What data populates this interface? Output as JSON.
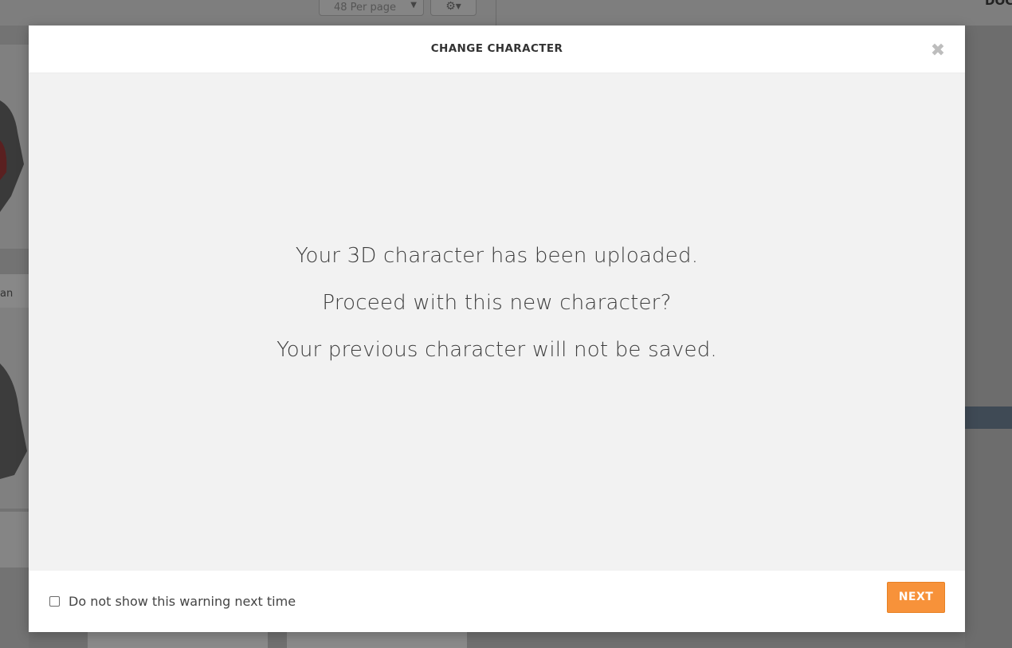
{
  "background": {
    "per_page_select": "48 Per page",
    "settings_icon": "gear-icon",
    "top_right_text": "DOC",
    "card_label_fragment": "an"
  },
  "modal": {
    "title": "CHANGE CHARACTER",
    "close_icon": "close-icon",
    "message_lines": [
      "Your 3D character has been uploaded.",
      "Proceed with this new character?",
      "Your previous character will not be saved."
    ],
    "footer": {
      "checkbox_label": "Do not show this warning next time",
      "checkbox_checked": false,
      "next_label": "NEXT"
    }
  },
  "colors": {
    "accent": "#f7923a",
    "body_bg": "#f2f2f2",
    "overlay": "#7a7a7a"
  }
}
